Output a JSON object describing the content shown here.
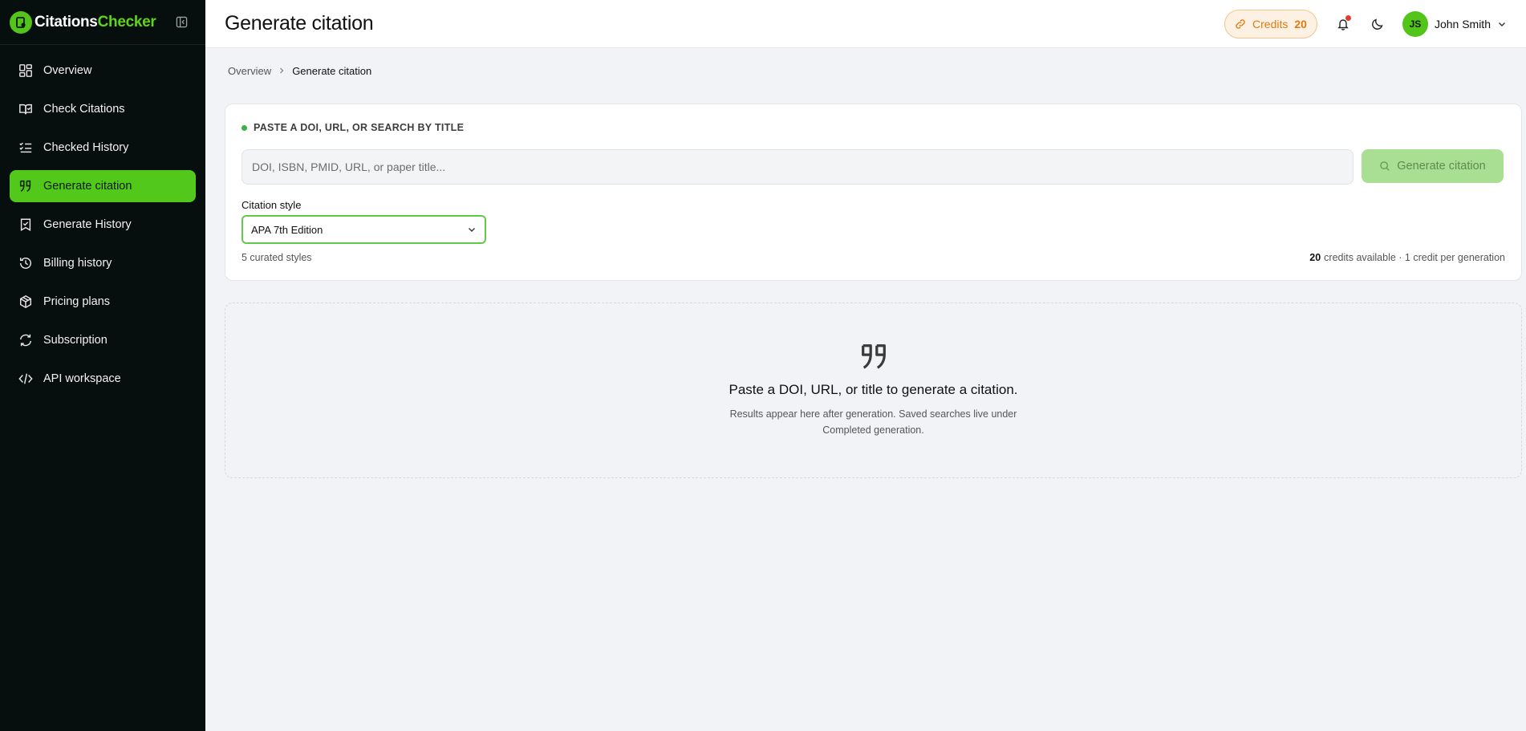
{
  "brand": {
    "name_part1": "Citations",
    "name_part2": "Checker",
    "accent": "#52c41a"
  },
  "sidebar": {
    "items": [
      {
        "label": "Overview",
        "icon": "layout-dashboard-icon"
      },
      {
        "label": "Check Citations",
        "icon": "book-check-icon"
      },
      {
        "label": "Checked History",
        "icon": "list-checks-icon"
      },
      {
        "label": "Generate citation",
        "icon": "quote-icon",
        "active": true
      },
      {
        "label": "Generate History",
        "icon": "bookmark-check-icon"
      },
      {
        "label": "Billing history",
        "icon": "history-icon"
      },
      {
        "label": "Pricing plans",
        "icon": "package-icon"
      },
      {
        "label": "Subscription",
        "icon": "refresh-icon"
      },
      {
        "label": "API workspace",
        "icon": "code-icon"
      }
    ]
  },
  "header": {
    "title": "Generate citation",
    "credits_label": "Credits",
    "credits_value": "20",
    "user": {
      "initials": "JS",
      "name": "John Smith"
    }
  },
  "breadcrumb": {
    "root": "Overview",
    "current": "Generate citation"
  },
  "form": {
    "section_label": "PASTE A DOI, URL, OR SEARCH BY TITLE",
    "input_placeholder": "DOI, ISBN, PMID, URL, or paper title...",
    "input_value": "",
    "button_label": "Generate citation",
    "style_label": "Citation style",
    "style_selected": "APA 7th Edition",
    "curated_text": "5 curated styles",
    "credits_available_num": "20",
    "credits_available_text": "credits available · 1 credit per generation"
  },
  "empty_state": {
    "title": "Paste a DOI, URL, or title to generate a citation.",
    "description": "Results appear here after generation. Saved searches live under Completed generation."
  }
}
